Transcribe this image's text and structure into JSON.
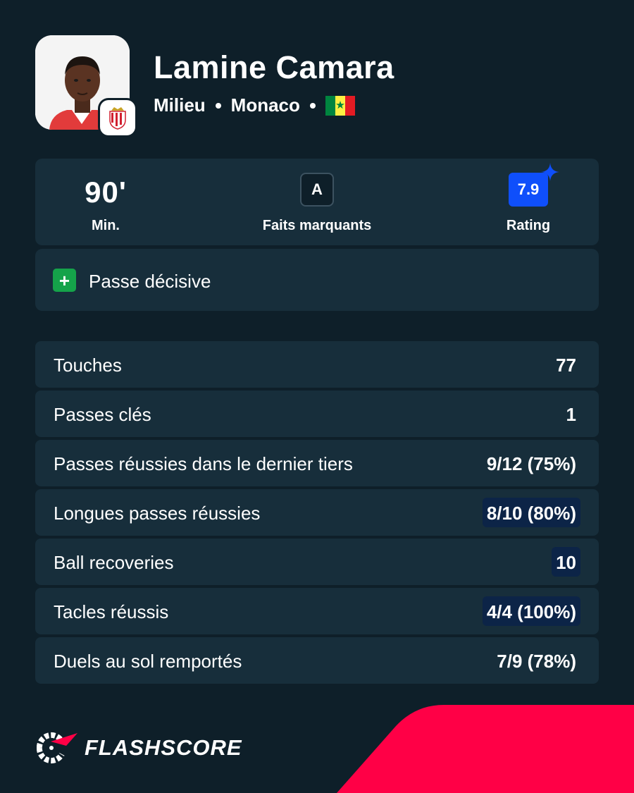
{
  "player": {
    "name": "Lamine Camara",
    "position": "Milieu",
    "club": "Monaco",
    "nationality_flag": "senegal-flag-icon"
  },
  "summary": {
    "minutes_value": "90'",
    "minutes_label": "Min.",
    "highlights_badge": "A",
    "highlights_label": "Faits marquants",
    "rating_value": "7.9",
    "rating_label": "Rating"
  },
  "events": [
    {
      "icon": "plus-icon",
      "label": "Passe décisive"
    }
  ],
  "stats": [
    {
      "label": "Touches",
      "value": "77",
      "highlighted": false
    },
    {
      "label": "Passes clés",
      "value": "1",
      "highlighted": false
    },
    {
      "label": "Passes réussies dans le dernier tiers",
      "value": "9/12 (75%)",
      "highlighted": false
    },
    {
      "label": "Longues passes réussies",
      "value": "8/10 (80%)",
      "highlighted": true
    },
    {
      "label": "Ball recoveries",
      "value": "10",
      "highlighted": true
    },
    {
      "label": "Tacles réussis",
      "value": "4/4 (100%)",
      "highlighted": true
    },
    {
      "label": "Duels au sol remportés",
      "value": "7/9 (78%)",
      "highlighted": false
    }
  ],
  "brand": {
    "logo_text": "FLASHSCORE"
  },
  "colors": {
    "background": "#0e1f29",
    "card": "#172e3b",
    "rating_blue": "#0f4ffb",
    "highlight": "#0c2447",
    "accent_red": "#ff0046",
    "success_green": "#15a34a"
  }
}
